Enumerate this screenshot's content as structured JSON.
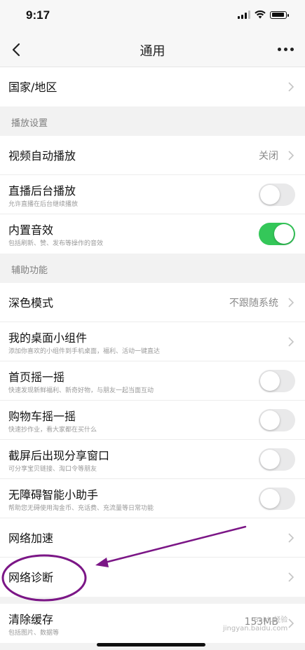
{
  "status_bar": {
    "time": "9:17"
  },
  "nav": {
    "title": "通用"
  },
  "rows_top": {
    "region": "国家/地区"
  },
  "sections": {
    "playback": {
      "header": "播放设置"
    },
    "assist": {
      "header": "辅助功能"
    }
  },
  "playback": {
    "autoplay": {
      "title": "视频自动播放",
      "value": "关闭"
    },
    "live_bg": {
      "title": "直播后台播放",
      "subtitle": "允许直播在后台继续播放",
      "on": false
    },
    "sound": {
      "title": "内置音效",
      "subtitle": "包括刷新、赞、发布等操作的音效",
      "on": true
    }
  },
  "assist": {
    "dark_mode": {
      "title": "深色模式",
      "value": "不跟随系统"
    },
    "widget": {
      "title": "我的桌面小组件",
      "subtitle": "添加你喜欢的小组件到手机桌面，福利、活动一键直达"
    },
    "shake_home": {
      "title": "首页摇一摇",
      "subtitle": "快速发现新鲜福利、新奇好物，与朋友一起当面互动",
      "on": false
    },
    "shake_cart": {
      "title": "购物车摇一摇",
      "subtitle": "快速抄作业，看大家都在买什么",
      "on": false
    },
    "screenshot_share": {
      "title": "截屏后出现分享窗口",
      "subtitle": "可分享宝贝链接、淘口令等朋友",
      "on": false
    },
    "accessibility": {
      "title": "无障碍智能小助手",
      "subtitle": "帮助您无碍使用淘金币、充话费、充流量等日常功能",
      "on": false
    },
    "net_speed": {
      "title": "网络加速"
    },
    "net_diag": {
      "title": "网络诊断"
    }
  },
  "cache": {
    "title": "清除缓存",
    "subtitle": "包括图片、数据等",
    "value": "153MB"
  },
  "watermark": {
    "line1": "Baidu经验",
    "line2": "jingyan.baidu.com"
  },
  "colors": {
    "switch_on": "#34c759",
    "annotation": "#7b1686"
  }
}
